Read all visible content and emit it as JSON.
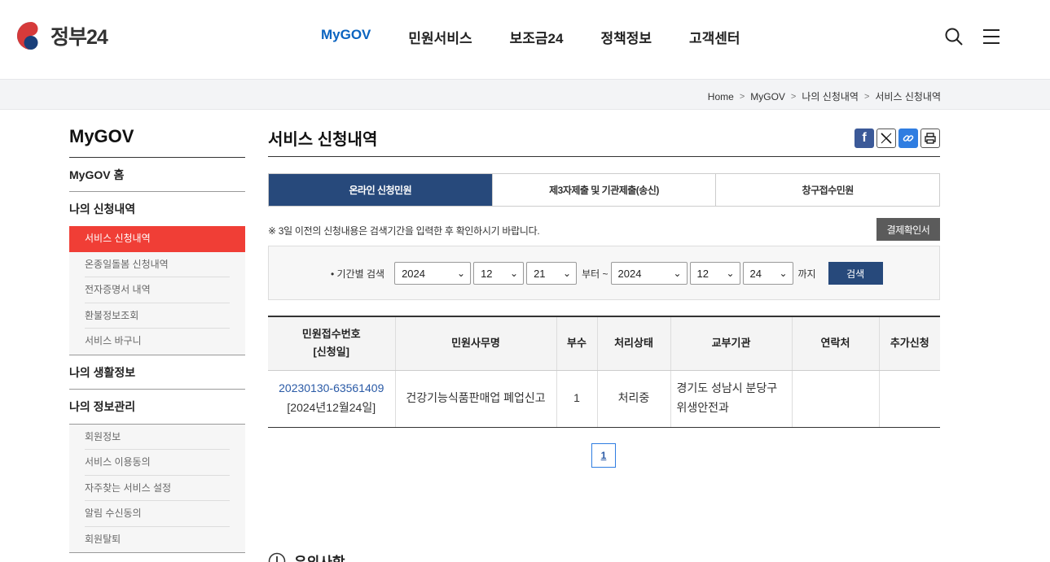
{
  "header": {
    "logo_text": "정부24",
    "nav": [
      "MyGOV",
      "민원서비스",
      "보조금24",
      "정책정보",
      "고객센터"
    ],
    "active_nav": "MyGOV"
  },
  "breadcrumb": [
    "Home",
    "MyGOV",
    "나의 신청내역",
    "서비스 신청내역"
  ],
  "sidebar": {
    "title": "MyGOV",
    "home": "MyGOV 홈",
    "apply": {
      "label": "나의 신청내역",
      "items": [
        "서비스 신청내역",
        "온종일돌봄 신청내역",
        "전자증명서 내역",
        "환불정보조회",
        "서비스 바구니"
      ]
    },
    "life": "나의 생활정보",
    "info": {
      "label": "나의 정보관리",
      "items": [
        "회원정보",
        "서비스 이용동의",
        "자주찾는 서비스 설정",
        "알림 수신동의",
        "회원탈퇴"
      ]
    }
  },
  "main": {
    "title": "서비스 신청내역",
    "tabs": [
      "온라인 신청민원",
      "제3자제출 및 기관제출(송신)",
      "창구접수민원"
    ],
    "notice": "※ 3일 이전의 신청내용은 검색기간을 입력한 후 확인하시기 바랍니다.",
    "pay_button": "결제확인서",
    "search": {
      "label": "• 기간별 검색",
      "from_year": "2024",
      "from_month": "12",
      "from_day": "21",
      "from_text": "부터 ~",
      "to_year": "2024",
      "to_month": "12",
      "to_day": "24",
      "to_text": "까지",
      "button": "검색"
    },
    "table": {
      "headers": [
        "민원접수번호",
        "[신청일]",
        "민원사무명",
        "부수",
        "처리상태",
        "교부기관",
        "연락처",
        "추가신청"
      ],
      "row": {
        "receipt_no": "20230130-63561409",
        "date": "[2024년12월24일]",
        "service": "건강기능식품판매업 폐업신고",
        "copies": "1",
        "status": "처리중",
        "org_line1": "경기도 성남시 분당구",
        "org_line2": "위생안전과",
        "contact": "",
        "extra": ""
      }
    },
    "page": "1",
    "caution_title": "유의사항"
  },
  "colors": {
    "accent": "#0b64c0",
    "navy": "#27497b",
    "active_red": "#f03e36"
  }
}
